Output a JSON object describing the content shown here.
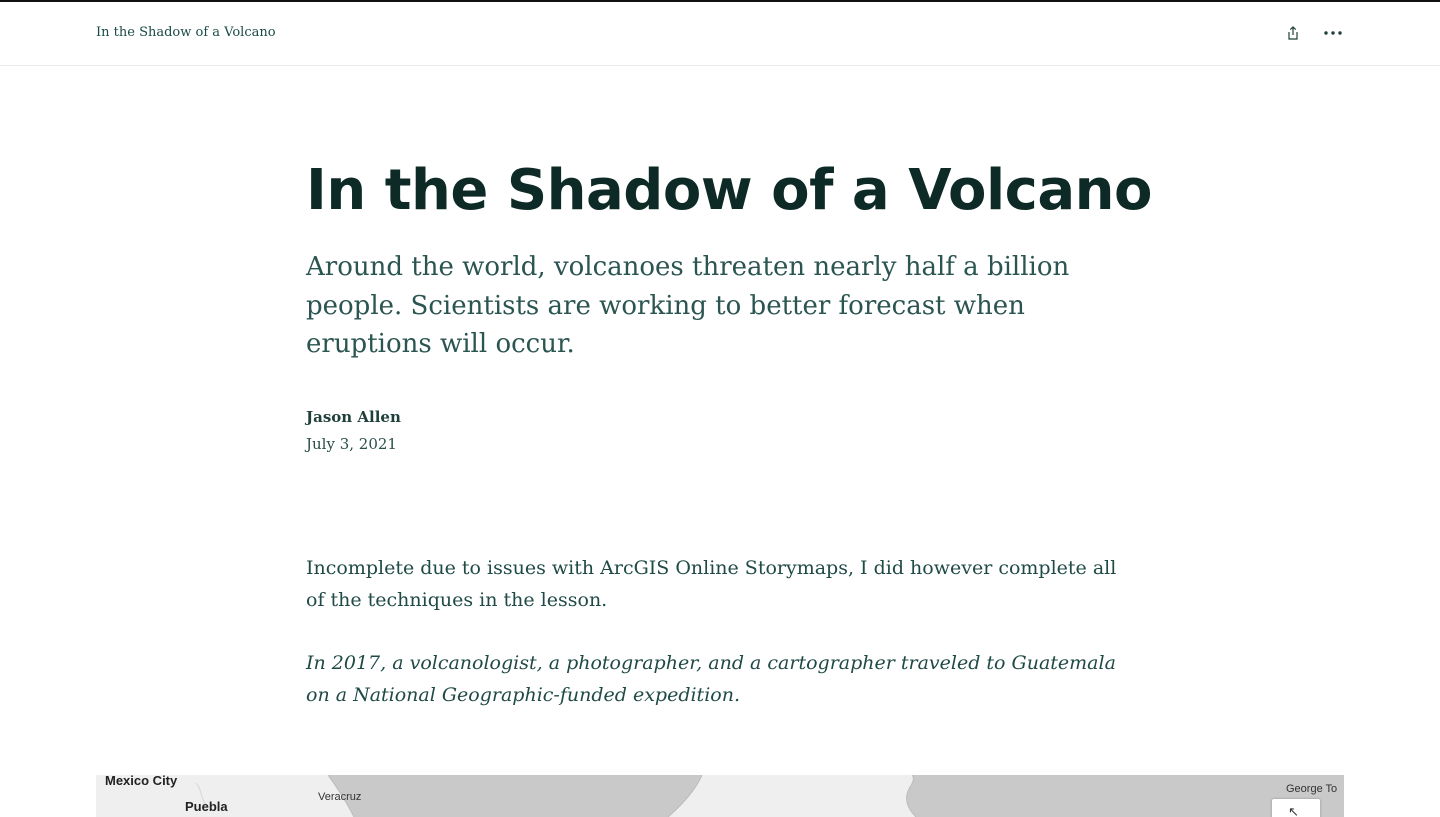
{
  "header": {
    "story_title": "In the Shadow of a Volcano",
    "icons": [
      "share-icon",
      "more-icon"
    ]
  },
  "story": {
    "title": "In the Shadow of a Volcano",
    "subtitle": "Around the world, volcanoes threaten nearly half a billion people. Scientists are working to better forecast when eruptions will occur.",
    "author": "Jason Allen",
    "date": "July 3, 2021",
    "paragraph_1": "Incomplete due to issues with ArcGIS Online Storymaps, I did however complete all of the techniques in the lesson.",
    "paragraph_2": "In 2017, a volcanologist, a photographer, and a cartographer traveled to Guatemala on a National Geographic-funded expedition."
  },
  "map": {
    "labels": {
      "mexico_city": "Mexico City",
      "puebla": "Puebla",
      "veracruz": "Veracruz",
      "george_town": "George To"
    },
    "control_icon": "expand-icon"
  },
  "colors": {
    "title": "#0e2a26",
    "text": "#1f4a45",
    "water": "#c9c9c9",
    "land": "#efefef"
  }
}
